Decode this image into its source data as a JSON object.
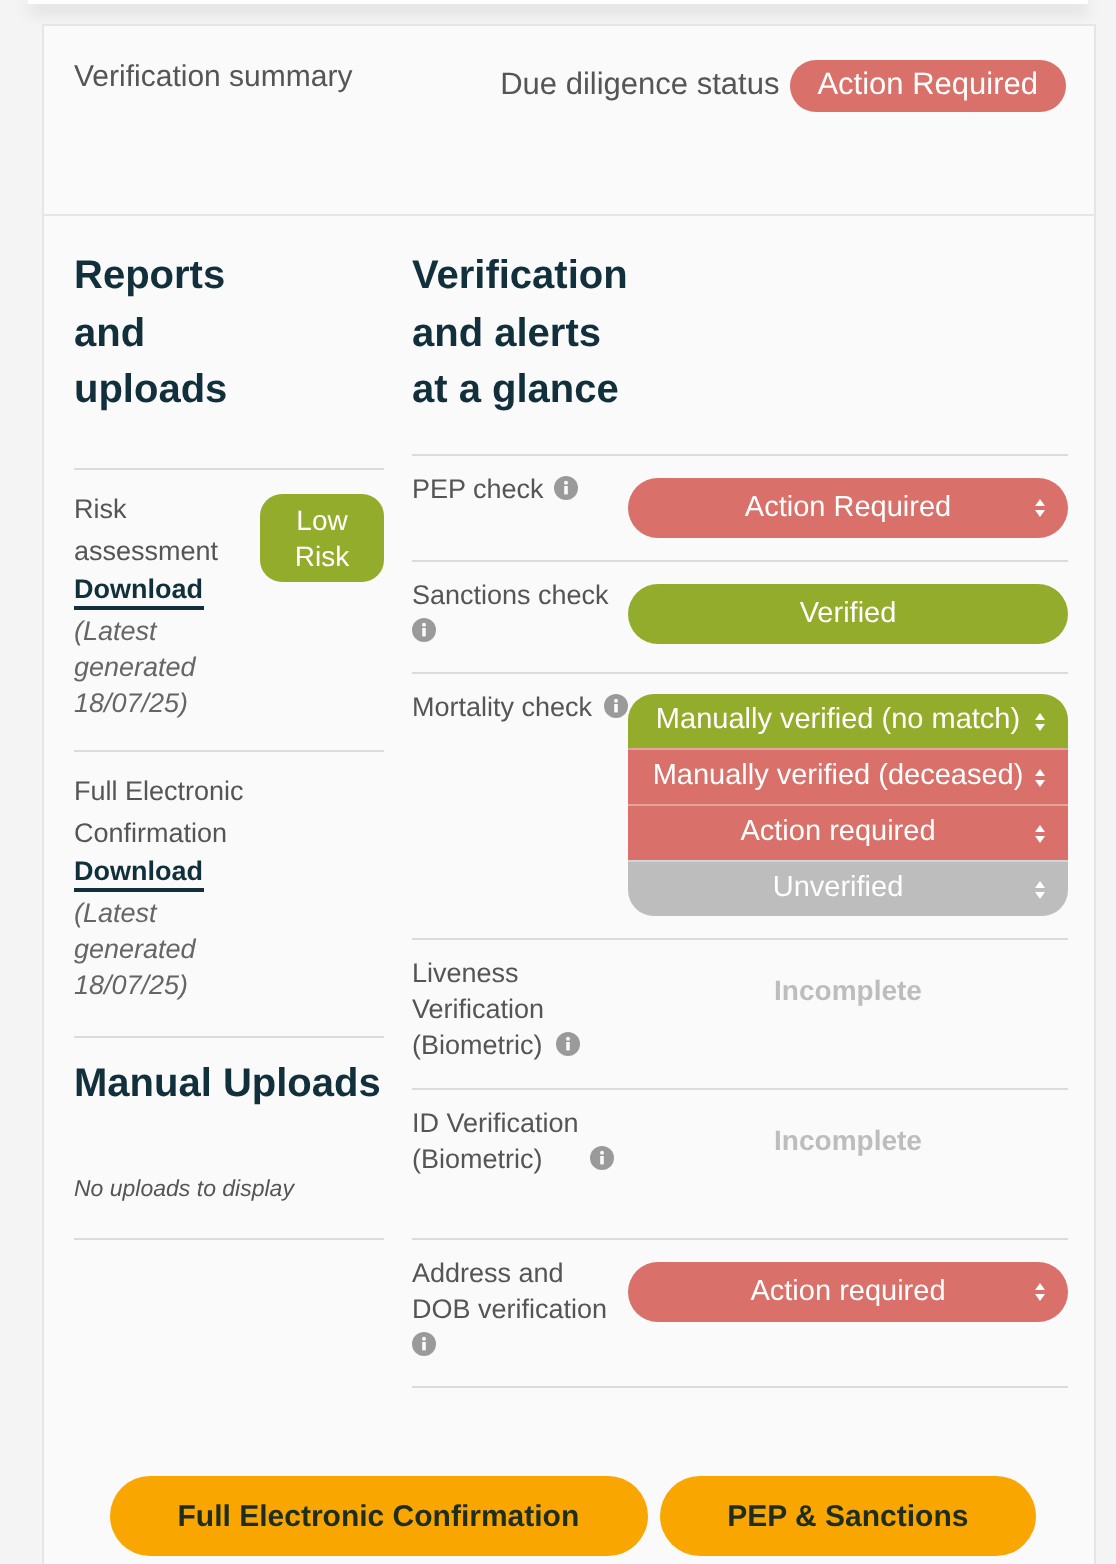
{
  "summary": {
    "title": "Verification summary",
    "status_label": "Due diligence status",
    "status": {
      "text": "Action Required",
      "color": "#d9706a"
    }
  },
  "reports": {
    "heading": "Reports and uploads",
    "items": [
      {
        "label": "Risk assessment",
        "link": "Download",
        "note": "(Latest generated 18/07/25)",
        "badge": {
          "text": "Low Risk",
          "color": "#94ac2c"
        }
      },
      {
        "label": "Full Electronic Confirmation",
        "link": "Download",
        "note": "(Latest generated 18/07/25)"
      }
    ]
  },
  "manual_uploads": {
    "heading": "Manual Uploads",
    "empty_text": "No uploads to display"
  },
  "checks": {
    "heading": "Verification and alerts at a glance",
    "rows": [
      {
        "label": "PEP check",
        "kind": "select",
        "options": [
          {
            "text": "Action Required",
            "color": "#d9706a"
          }
        ]
      },
      {
        "label": "Sanctions check",
        "kind": "status",
        "options": [
          {
            "text": "Verified",
            "color": "#94ac2c"
          }
        ]
      },
      {
        "label": "Mortality check",
        "kind": "select",
        "options": [
          {
            "text": "Manually verified (no match)",
            "color": "#94ac2c"
          },
          {
            "text": "Manually verified (deceased)",
            "color": "#d9706a"
          },
          {
            "text": "Action required",
            "color": "#d9706a"
          },
          {
            "text": "Unverified",
            "color": "#bdbdbd"
          }
        ]
      },
      {
        "label": "Liveness Verification (Biometric)",
        "kind": "text",
        "options": [
          {
            "text": "Incomplete"
          }
        ]
      },
      {
        "label": "ID Verification (Biometric)",
        "kind": "text",
        "options": [
          {
            "text": "Incomplete"
          }
        ]
      },
      {
        "label": "Address and DOB verification",
        "kind": "select",
        "options": [
          {
            "text": "Action required",
            "color": "#d9706a"
          }
        ]
      }
    ]
  },
  "buttons": [
    {
      "text": "Full Electronic Confirmation"
    },
    {
      "text": "PEP & Sanctions"
    }
  ]
}
